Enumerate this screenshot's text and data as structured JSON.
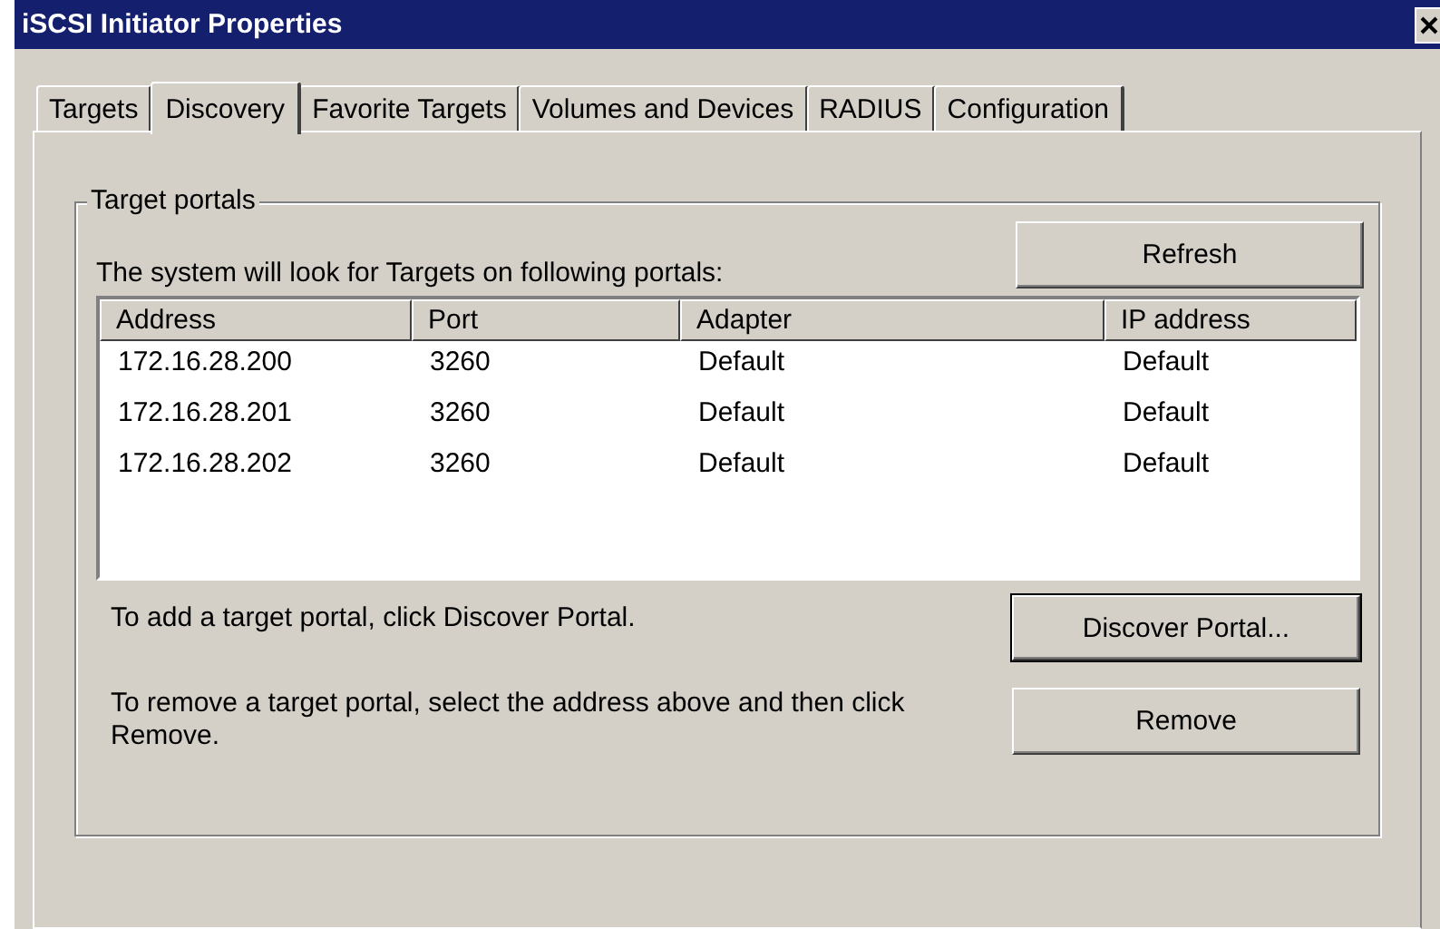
{
  "window": {
    "title": "iSCSI Initiator Properties"
  },
  "tabs": [
    {
      "label": "Targets",
      "selected": false
    },
    {
      "label": "Discovery",
      "selected": true
    },
    {
      "label": "Favorite Targets",
      "selected": false
    },
    {
      "label": "Volumes and Devices",
      "selected": false
    },
    {
      "label": "RADIUS",
      "selected": false
    },
    {
      "label": "Configuration",
      "selected": false
    }
  ],
  "group": {
    "title": "Target portals",
    "intro": "The system will look for Targets on following portals:",
    "refresh_button": "Refresh"
  },
  "table": {
    "columns": [
      "Address",
      "Port",
      "Adapter",
      "IP address"
    ],
    "rows": [
      [
        "172.16.28.200",
        "3260",
        "Default",
        "Default"
      ],
      [
        "172.16.28.201",
        "3260",
        "Default",
        "Default"
      ],
      [
        "172.16.28.202",
        "3260",
        "Default",
        "Default"
      ]
    ]
  },
  "add_hint": "To add a target portal, click Discover Portal.",
  "discover_button": "Discover Portal...",
  "remove_hint": "To remove a target portal, select the address above and then click Remove.",
  "remove_button": "Remove"
}
